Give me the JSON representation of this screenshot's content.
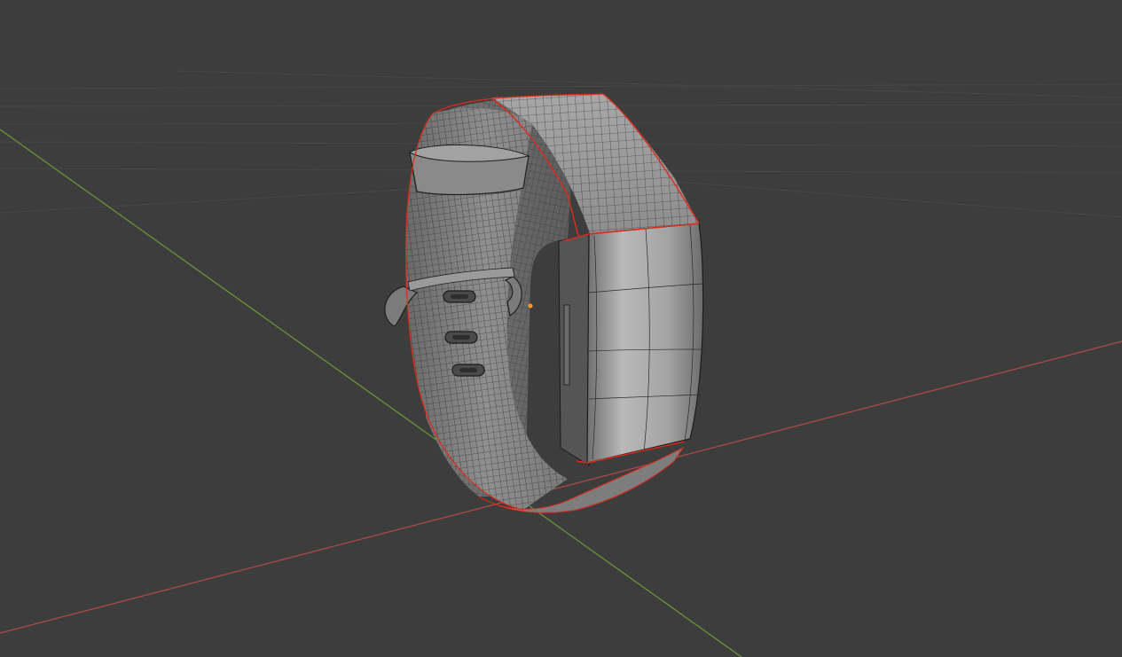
{
  "viewport": {
    "background": "#3d3d3d",
    "grid_color": "#474747",
    "x_axis_color": "#b34a4a",
    "y_axis_color": "#6a9a3a",
    "origin_color": "#ff9a1f"
  },
  "model": {
    "object": "fitness-tracker-band",
    "display": "wireframe-overlay",
    "body_color": "#8a8a8a",
    "highlight_color": "#c4c4c4",
    "wire_color": "#1c1c1c",
    "seam_color": "#e02a1a"
  }
}
